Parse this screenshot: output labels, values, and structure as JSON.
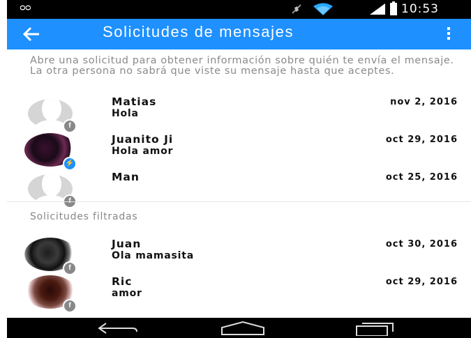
{
  "status_bar": {
    "voicemail_icon": "voicemail-icon",
    "time": "10:53"
  },
  "app_bar": {
    "title": "Solicitudes de mensajes",
    "back_icon": "arrow-back-icon",
    "menu_icon": "more-vert-icon",
    "color": "#1e90ff"
  },
  "info_text": "Abre una solicitud para obtener información sobre quién te envía el mensaje. La otra persona no sabrá que viste su mensaje hasta que aceptes.",
  "requests": [
    {
      "name": "Matias",
      "preview": "Hola",
      "date": "nov 2, 2016",
      "avatar": "default",
      "badge": "facebook"
    },
    {
      "name": "Juanito Ji",
      "preview": "Hola amor",
      "date": "oct 29, 2016",
      "avatar": "photo",
      "badge": "messenger"
    },
    {
      "name": "Man",
      "preview": "",
      "date": "oct 25, 2016",
      "avatar": "default",
      "badge": "facebook"
    }
  ],
  "filtered_section": {
    "title": "Solicitudes filtradas",
    "items": [
      {
        "name": "Juan",
        "preview": "Ola mamasita",
        "date": "oct 30, 2016",
        "avatar": "photo",
        "badge": "facebook"
      },
      {
        "name": "Ric",
        "preview": "amor",
        "date": "oct 29, 2016",
        "avatar": "photo",
        "badge": "facebook"
      }
    ]
  },
  "nav_bar": {
    "back": "nav-back-icon",
    "home": "nav-home-icon",
    "recents": "nav-recents-icon"
  }
}
